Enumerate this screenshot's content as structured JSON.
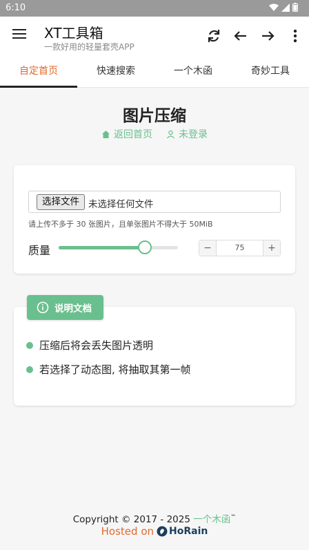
{
  "statusbar": {
    "time": "6:10"
  },
  "appbar": {
    "title": "XT工具箱",
    "subtitle": "一款好用的轻量套壳APP"
  },
  "tabs": [
    {
      "label": "自定首页",
      "active": true
    },
    {
      "label": "快速搜索",
      "active": false
    },
    {
      "label": "一个木函",
      "active": false
    },
    {
      "label": "奇妙工具",
      "active": false
    }
  ],
  "page": {
    "title": "图片压缩",
    "back_home": "返回首页",
    "not_logged_in": "未登录"
  },
  "uploader": {
    "choose_file": "选择文件",
    "no_file": "未选择任何文件",
    "hint": "请上传不多于 30 张图片，且单张图片不得大于 50MiB",
    "quality_label": "质量",
    "quality_value": "75",
    "quality_fraction": 0.72,
    "minus": "−",
    "plus": "+"
  },
  "docs": {
    "badge": "说明文档",
    "items": [
      "压缩后将会丢失图片透明",
      "若选择了动态图, 将抽取其第一帧"
    ]
  },
  "footer": {
    "copyright": "Copyright © 2017 - 2025",
    "brand": "一个木函",
    "tm": "™",
    "hosted_on": "Hosted on",
    "host_name": "HoRain"
  },
  "colors": {
    "accent": "#6abf8e",
    "active_tab": "#e06a2c",
    "statusbar": "#9a9a9a"
  }
}
